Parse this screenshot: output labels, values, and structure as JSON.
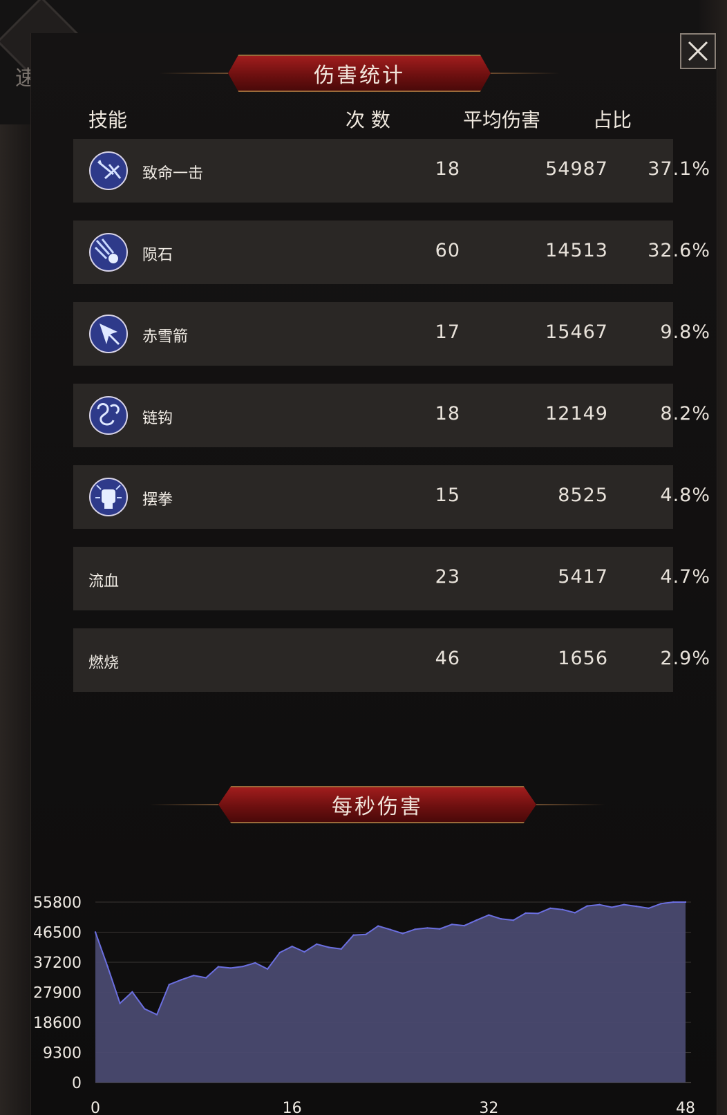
{
  "background": {
    "quick_battle_label": "速 战"
  },
  "close_button": {
    "icon": "close-icon"
  },
  "damage_stats": {
    "title": "伤害统计",
    "columns": {
      "skill": "技能",
      "count": "次 数",
      "avg_damage": "平均伤害",
      "share": "占比"
    },
    "rows": [
      {
        "icon": "critical-strike-icon",
        "name": "致命一击",
        "count": "18",
        "avg": "54987",
        "share": "37.1%"
      },
      {
        "icon": "meteor-icon",
        "name": "陨石",
        "count": "60",
        "avg": "14513",
        "share": "32.6%"
      },
      {
        "icon": "arrow-icon",
        "name": "赤雪箭",
        "count": "17",
        "avg": "15467",
        "share": "9.8%"
      },
      {
        "icon": "chain-hook-icon",
        "name": "链钩",
        "count": "18",
        "avg": "12149",
        "share": "8.2%"
      },
      {
        "icon": "fist-icon",
        "name": "摆拳",
        "count": "15",
        "avg": "8525",
        "share": "4.8%"
      },
      {
        "icon": "",
        "name": "流血",
        "count": "23",
        "avg": "5417",
        "share": "4.7%"
      },
      {
        "icon": "",
        "name": "燃烧",
        "count": "46",
        "avg": "1656",
        "share": "2.9%"
      }
    ]
  },
  "dps": {
    "title": "每秒伤害",
    "chart_data": {
      "type": "area",
      "title": "",
      "xlabel": "",
      "ylabel": "",
      "xlim": [
        0,
        48
      ],
      "ylim": [
        0,
        55800
      ],
      "x_ticks": [
        "0",
        "16",
        "32",
        "48"
      ],
      "y_ticks": [
        "0",
        "9300",
        "18600",
        "27900",
        "37200",
        "46500",
        "55800"
      ],
      "grid": true,
      "color": "#4a4a70",
      "line_color": "#6b6fe0",
      "x": [
        0,
        1,
        2,
        3,
        4,
        5,
        6,
        7,
        8,
        9,
        10,
        11,
        12,
        13,
        14,
        15,
        16,
        17,
        18,
        19,
        20,
        21,
        22,
        23,
        24,
        25,
        26,
        27,
        28,
        29,
        30,
        31,
        32,
        33,
        34,
        35,
        36,
        37,
        38,
        39,
        40,
        41,
        42,
        43,
        44,
        45,
        46,
        47,
        48
      ],
      "values": [
        46500,
        35800,
        24500,
        28000,
        22800,
        21000,
        30300,
        31800,
        33100,
        32400,
        35800,
        35400,
        35900,
        37000,
        35100,
        40200,
        42100,
        40400,
        42800,
        41800,
        41300,
        45600,
        45800,
        48400,
        47300,
        46100,
        47400,
        47800,
        47500,
        48900,
        48500,
        50200,
        51800,
        50600,
        50200,
        52400,
        52300,
        53900,
        53500,
        52500,
        54600,
        55000,
        54200,
        55000,
        54500,
        53900,
        55300,
        55800,
        55800
      ]
    }
  }
}
